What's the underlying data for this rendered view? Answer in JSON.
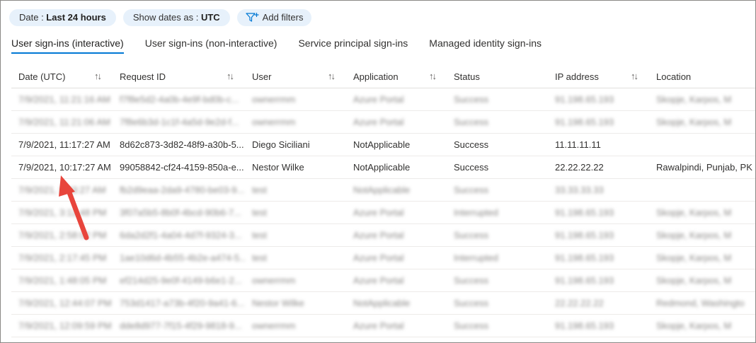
{
  "filters": {
    "date_label": "Date : ",
    "date_value": "Last 24 hours",
    "showdates_label": "Show dates as : ",
    "showdates_value": "UTC",
    "add_filters": "Add filters"
  },
  "tabs": [
    {
      "label": "User sign-ins (interactive)",
      "active": true
    },
    {
      "label": "User sign-ins (non-interactive)",
      "active": false
    },
    {
      "label": "Service principal sign-ins",
      "active": false
    },
    {
      "label": "Managed identity sign-ins",
      "active": false
    }
  ],
  "columns": [
    "Date (UTC)",
    "Request ID",
    "User",
    "Application",
    "Status",
    "IP address",
    "Location"
  ],
  "rows": [
    {
      "date": "7/9/2021, 11:21:16 AM",
      "request_id": "f7f8e5d2-4a0b-4e9f-bd0b-c...",
      "user": "ownerrmm",
      "app": "Azure Portal",
      "status": "Success",
      "ip": "91.198.65.193",
      "location": "Skopje, Karpos, M"
    },
    {
      "date": "7/9/2021, 11:21:06 AM",
      "request_id": "7f8e6b3d-1c1f-4a5d-9e2d-f...",
      "user": "ownerrmm",
      "app": "Azure Portal",
      "status": "Success",
      "ip": "91.198.65.193",
      "location": "Skopje, Karpos, M"
    },
    {
      "date": "7/9/2021, 11:17:27 AM",
      "request_id": "8d62c873-3d82-48f9-a30b-5...",
      "user": "Diego Siciliani",
      "app": "NotApplicable",
      "status": "Success",
      "ip": "11.11.11.11",
      "location": ""
    },
    {
      "date": "7/9/2021, 10:17:27 AM",
      "request_id": "99058842-cf24-4159-850a-e...",
      "user": "Nestor Wilke",
      "app": "NotApplicable",
      "status": "Success",
      "ip": "22.22.22.22",
      "location": "Rawalpindi, Punjab, PK"
    },
    {
      "date": "7/9/2021, 9:43:27 AM",
      "request_id": "fb2d9eaa-2da9-4780-be03-9...",
      "user": "test",
      "app": "NotApplicable",
      "status": "Success",
      "ip": "33.33.33.33",
      "location": ""
    },
    {
      "date": "7/9/2021, 3:12:48 PM",
      "request_id": "3f07a5b5-8b0f-4bcd-90b6-7...",
      "user": "test",
      "app": "Azure Portal",
      "status": "Interrupted",
      "ip": "91.198.65.193",
      "location": "Skopje, Karpos, M"
    },
    {
      "date": "7/9/2021, 2:58:02 PM",
      "request_id": "6da2d2f1-4a04-4d7f-9324-3...",
      "user": "test",
      "app": "Azure Portal",
      "status": "Success",
      "ip": "91.198.65.193",
      "location": "Skopje, Karpos, M"
    },
    {
      "date": "7/9/2021, 2:17:45 PM",
      "request_id": "1ae10d6d-4b55-4b2e-a474-5...",
      "user": "test",
      "app": "Azure Portal",
      "status": "Interrupted",
      "ip": "91.198.65.193",
      "location": "Skopje, Karpos, M"
    },
    {
      "date": "7/9/2021, 1:48:05 PM",
      "request_id": "ef214d25-9e0f-4149-b6e1-2...",
      "user": "ownerrmm",
      "app": "Azure Portal",
      "status": "Success",
      "ip": "91.198.65.193",
      "location": "Skopje, Karpos, M"
    },
    {
      "date": "7/9/2021, 12:44:07 PM",
      "request_id": "753d1417-a73b-4f20-9a41-6...",
      "user": "Nestor Wilke",
      "app": "NotApplicable",
      "status": "Success",
      "ip": "22.22.22.22",
      "location": "Redmond, Washingto"
    },
    {
      "date": "7/9/2021, 12:09:59 PM",
      "request_id": "dde8d977-7f15-4f29-9818-9...",
      "user": "ownerrmm",
      "app": "Azure Portal",
      "status": "Success",
      "ip": "91.198.65.193",
      "location": "Skopje, Karpos, M"
    }
  ],
  "row_blurred": [
    true,
    true,
    false,
    false,
    true,
    true,
    true,
    true,
    true,
    true,
    true
  ],
  "colors": {
    "accent": "#0078d4",
    "pill_bg": "#e7f1fb",
    "annotation_arrow": "#e8453c"
  }
}
